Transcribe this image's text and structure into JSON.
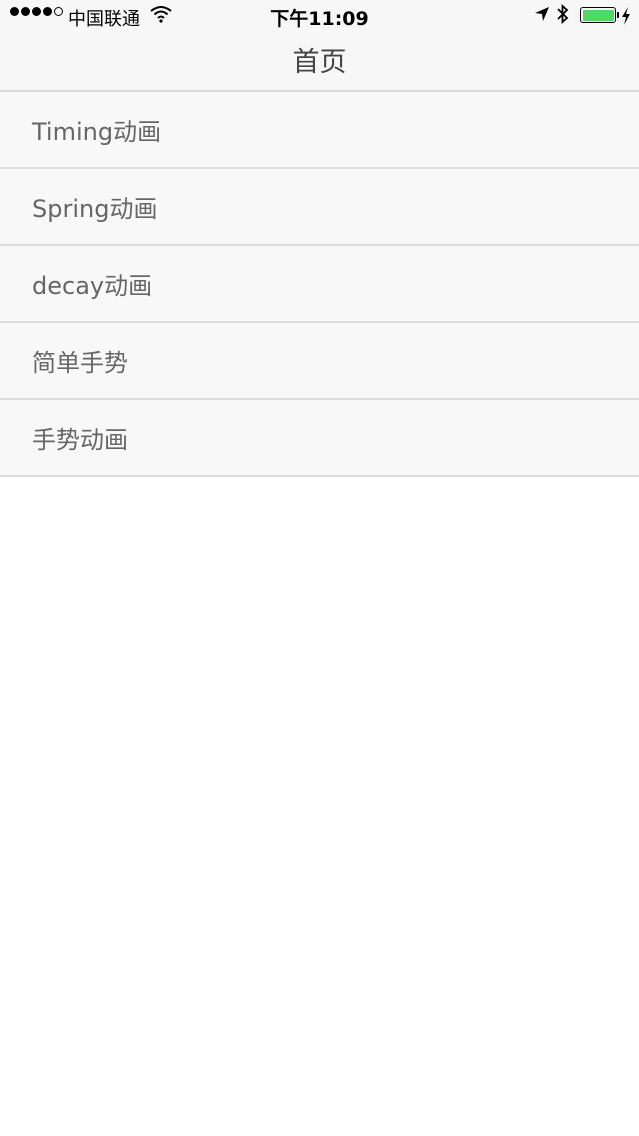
{
  "status": {
    "carrier": "中国联通",
    "time": "下午11:09",
    "battery_level": 1.0
  },
  "nav": {
    "title": "首页"
  },
  "list": {
    "items": [
      {
        "label": "Timing动画"
      },
      {
        "label": "Spring动画"
      },
      {
        "label": "decay动画"
      },
      {
        "label": "简单手势"
      },
      {
        "label": "手势动画"
      }
    ]
  },
  "colors": {
    "battery": "#4cd964",
    "background": "#ffffff",
    "bar": "#f7f7f7"
  }
}
